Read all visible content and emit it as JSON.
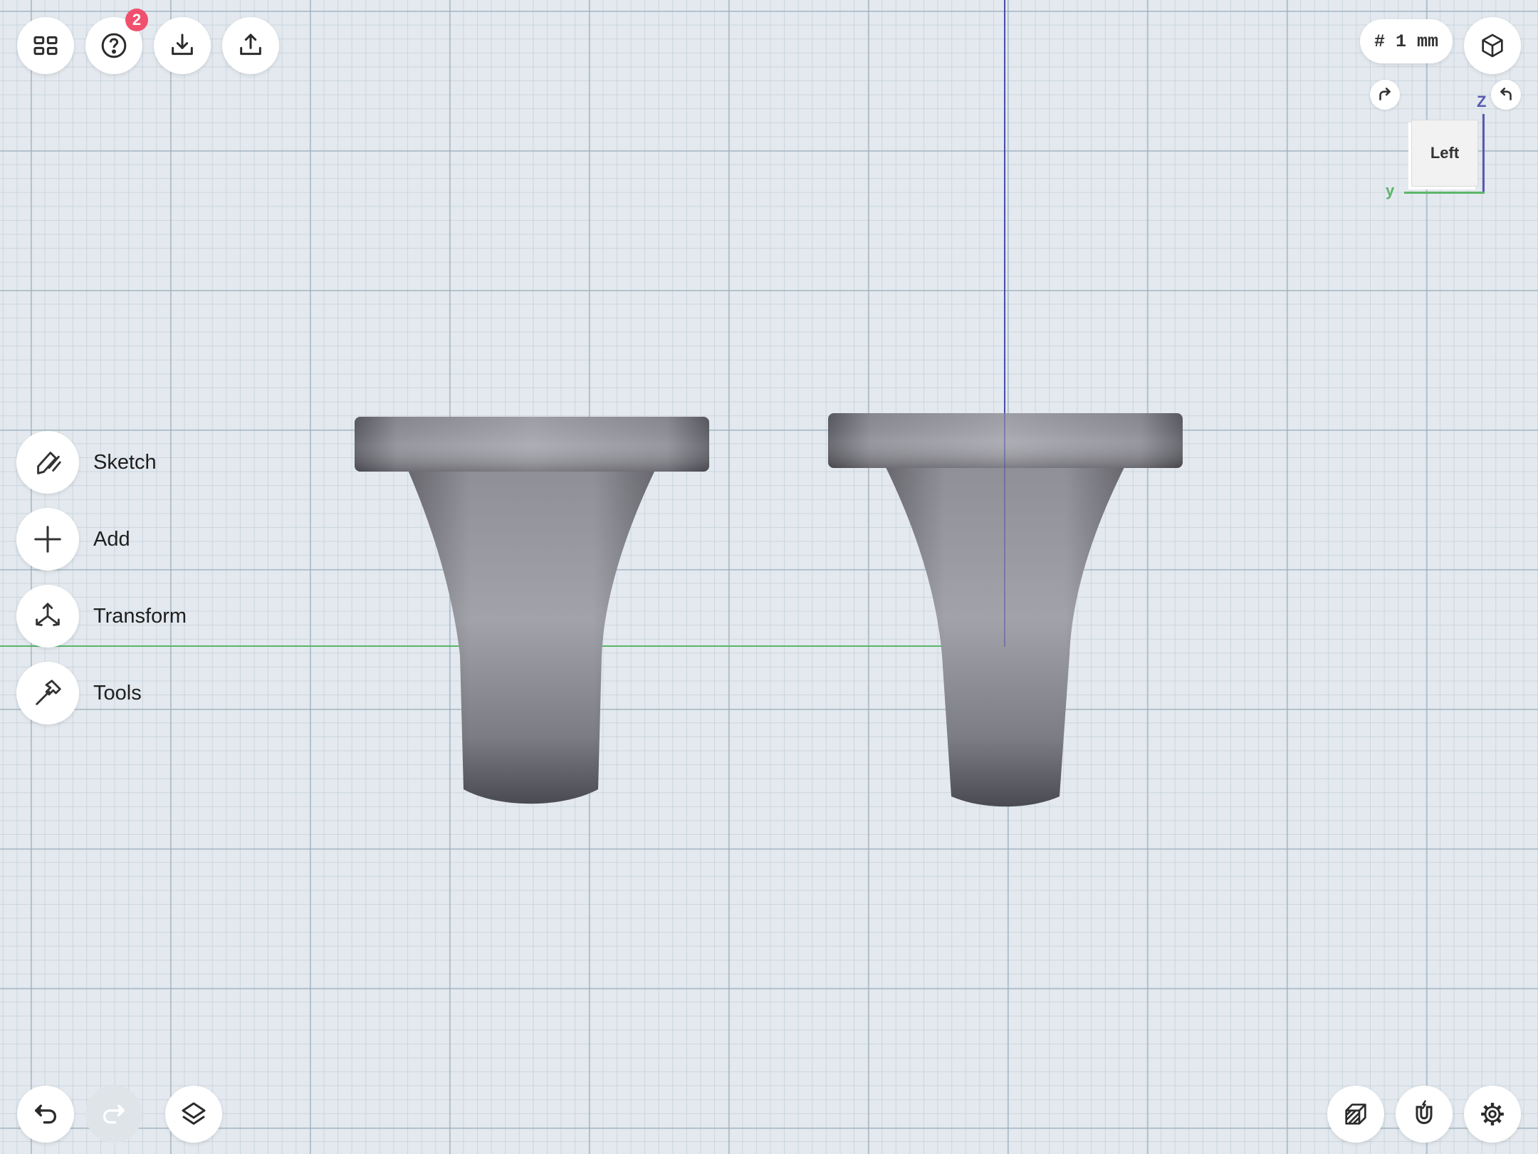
{
  "toolbar": {
    "buttons": [
      {
        "icon": "grid-icon",
        "label": "Menu"
      },
      {
        "icon": "help-icon",
        "label": "Help"
      },
      {
        "icon": "import-icon",
        "label": "Import"
      },
      {
        "icon": "export-icon",
        "label": "Export"
      }
    ],
    "help_badge_count": "2"
  },
  "grid_unit": "# 1 mm",
  "view_cube": {
    "face_label": "Left",
    "axis_z_label": "Z",
    "axis_y_label": "y"
  },
  "side_menu": [
    {
      "label": "Sketch",
      "icon": "sketch-pencil-icon"
    },
    {
      "label": "Add",
      "icon": "plus-icon"
    },
    {
      "label": "Transform",
      "icon": "transform-icon"
    },
    {
      "label": "Tools",
      "icon": "hammer-icon"
    }
  ],
  "bottom_toolbar": {
    "undo_icon": "undo-icon",
    "redo_icon": "redo-icon",
    "redo_enabled": false,
    "layers_icon": "layers-icon",
    "render_mode_icon": "render-mode-icon",
    "snap_icon": "magnet-icon",
    "settings_icon": "gear-icon"
  },
  "colors": {
    "axis_green": "#5bb56a",
    "axis_blue": "#4a4aa8",
    "badge_red": "#f0506e",
    "model_gray": "#9a9aa2"
  }
}
